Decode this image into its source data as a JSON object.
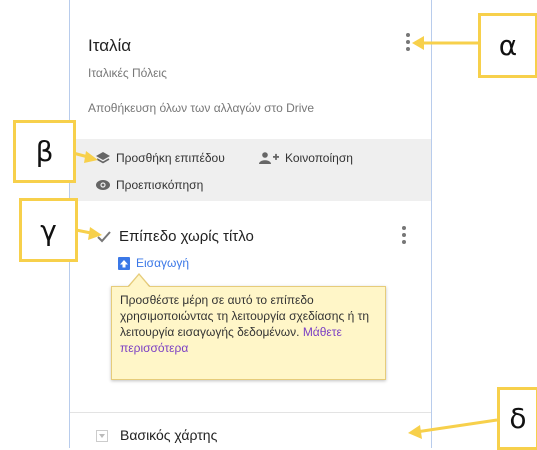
{
  "map": {
    "title": "Ιταλία",
    "description": "Ιταλικές Πόλεις",
    "save_status": "Αποθήκευση όλων των αλλαγών στο Drive"
  },
  "toolbar": {
    "add_layer": "Προσθήκη επιπέδου",
    "share": "Κοινοποίηση",
    "preview": "Προεπισκόπηση"
  },
  "layer": {
    "name": "Επίπεδο χωρίς τίτλο",
    "import_label": "Εισαγωγή",
    "checked": true
  },
  "tooltip": {
    "text": "Προσθέστε μέρη σε αυτό το επίπεδο χρησιμοποιώντας τη λειτουργία σχεδίασης ή τη λειτουργία εισαγωγής δεδομένων.",
    "link": "Μάθετε περισσότερα"
  },
  "basemap": {
    "label": "Βασικός χάρτης"
  },
  "callouts": {
    "a": "α",
    "b": "β",
    "c": "γ",
    "d": "δ"
  },
  "icons": {
    "menu": "more-vert-icon",
    "layers": "layers-icon",
    "add_person": "person-add-icon",
    "eye": "eye-icon",
    "checkbox": "checkbox-icon",
    "import": "upload-icon",
    "expand": "triangle-down-icon"
  },
  "colors": {
    "callout_border": "#f7d04b",
    "link_blue": "#3b78e7",
    "tooltip_bg": "#fff6c8",
    "learn_more": "#7b3fc4"
  }
}
